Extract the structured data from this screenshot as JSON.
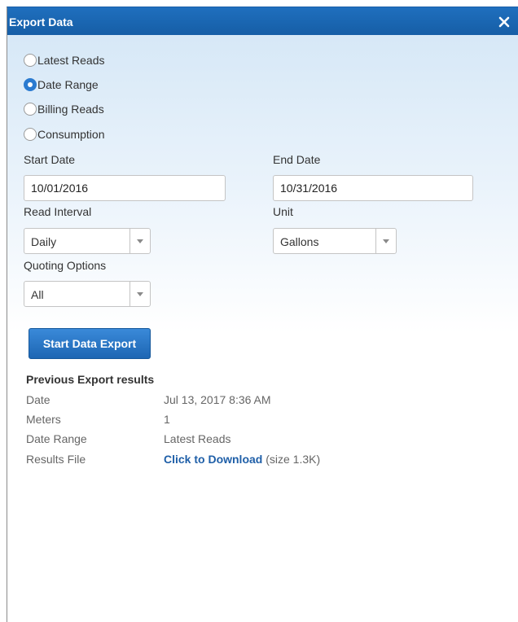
{
  "dialog": {
    "title": "Export Data",
    "close_label": "×"
  },
  "export_type": {
    "options": [
      {
        "label": "Latest Reads",
        "checked": false
      },
      {
        "label": "Date Range",
        "checked": true
      },
      {
        "label": "Billing Reads",
        "checked": false
      },
      {
        "label": "Consumption",
        "checked": false
      }
    ]
  },
  "form": {
    "start_date_label": "Start Date",
    "start_date_value": "10/01/2016",
    "end_date_label": "End Date",
    "end_date_value": "10/31/2016",
    "read_interval_label": "Read Interval",
    "read_interval_value": "Daily",
    "unit_label": "Unit",
    "unit_value": "Gallons",
    "quoting_label": "Quoting Options",
    "quoting_value": "All"
  },
  "actions": {
    "start_export_label": "Start Data Export"
  },
  "previous_results": {
    "heading": "Previous Export results",
    "rows": [
      {
        "label": "Date",
        "value": "Jul 13, 2017 8:36 AM"
      },
      {
        "label": "Meters",
        "value": "1"
      },
      {
        "label": "Date Range",
        "value": "Latest Reads"
      }
    ],
    "results_file_label": "Results File",
    "download_link_text": "Click to Download",
    "download_size_text": "(size 1.3K)"
  },
  "colors": {
    "titlebar": "#1f6fbe",
    "accent": "#2b7bd0",
    "link": "#1f5fa8"
  }
}
